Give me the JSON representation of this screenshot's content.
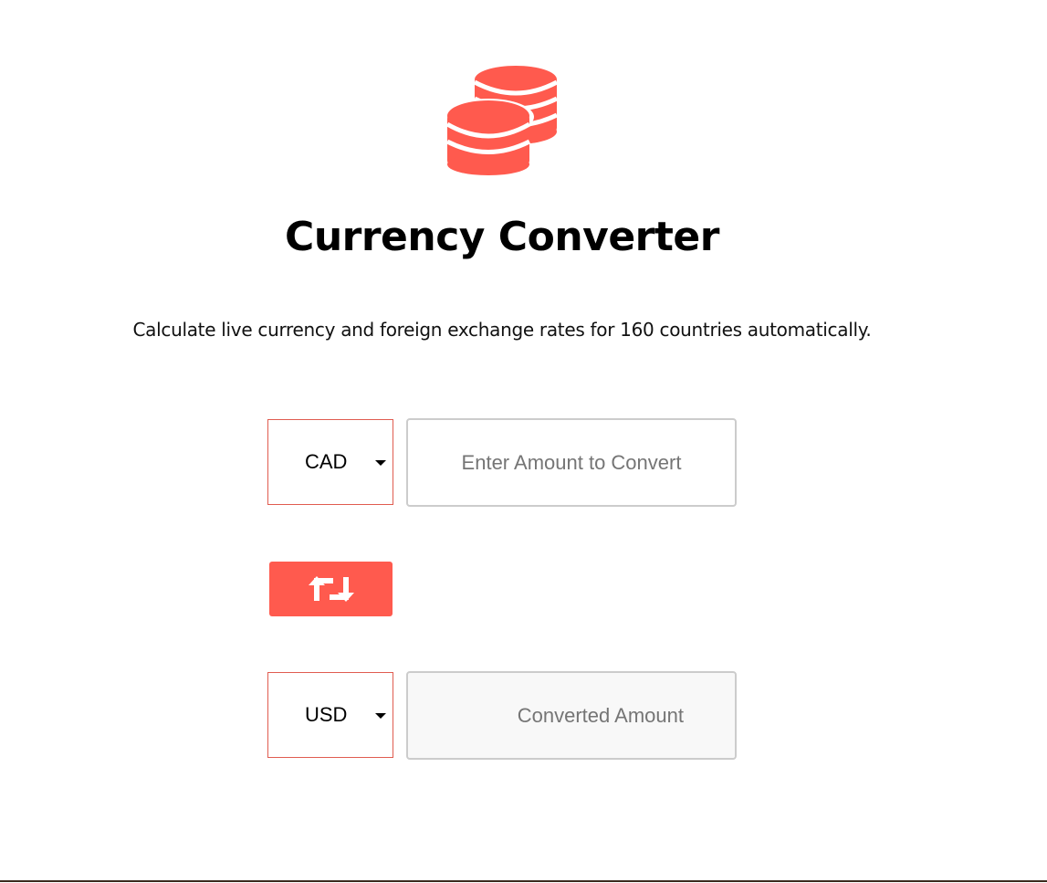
{
  "header": {
    "logo_icon": "coins-icon",
    "title": "Currency Converter",
    "subtitle": "Calculate live currency and foreign exchange rates for 160 countries automatically."
  },
  "converter": {
    "from": {
      "currency": "CAD",
      "amount_value": "",
      "amount_placeholder": "Enter Amount to Convert"
    },
    "swap": {
      "icon": "swap-arrows-icon"
    },
    "to": {
      "currency": "USD",
      "amount_value": "",
      "amount_placeholder": "Converted Amount"
    }
  },
  "colors": {
    "accent": "#ff5a4e",
    "select_border": "#e05c50",
    "input_border": "#cccccc",
    "converted_bg": "#f8f8f8",
    "text": "#000000"
  }
}
